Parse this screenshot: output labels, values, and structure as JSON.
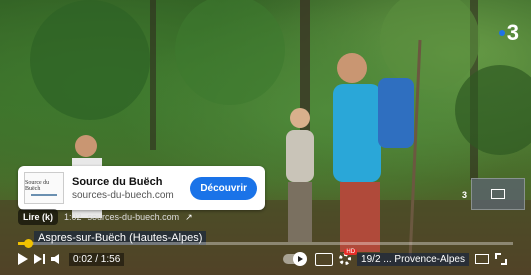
{
  "channel": {
    "logo_text": "3",
    "accent": "#1e73e8"
  },
  "ad": {
    "title": "Source du Buëch",
    "url": "sources-du-buech.com",
    "cta_label": "Découvrir",
    "logo_text": "Source du Buëch",
    "cta_color": "#1a73e8"
  },
  "ad_bar": {
    "read_label": "Lire (k)",
    "time": "1:02",
    "domain": "sources-du-buech.com"
  },
  "caption": {
    "text": "Aspres-sur-Buëch (Hautes-Alpes)"
  },
  "player": {
    "progress": 0.02,
    "progress_color": "#f2c200",
    "timecode": "0:02 / 1:56",
    "date_region": "19/2 ... Provence-Alpes",
    "queue_count": "3",
    "autoplay_on": true
  }
}
